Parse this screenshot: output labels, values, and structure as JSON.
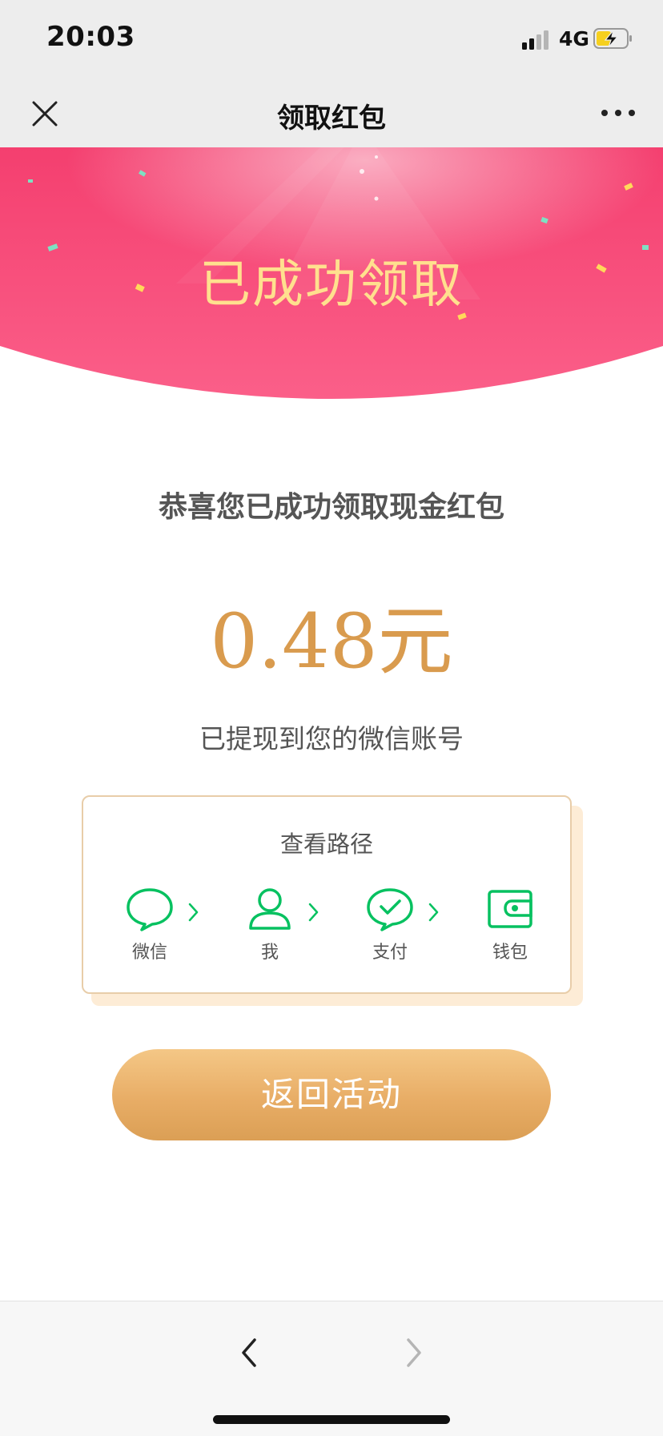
{
  "status_bar": {
    "time": "20:03",
    "network": "4G",
    "icons": [
      "signal-icon",
      "battery-charging-icon"
    ]
  },
  "nav": {
    "title": "领取红包",
    "close_icon": "close-icon",
    "more_icon": "more-icon"
  },
  "banner": {
    "title": "已成功领取"
  },
  "content": {
    "congrats": "恭喜您已成功领取现金红包",
    "amount": "0.48元",
    "withdrawn": "已提现到您的微信账号"
  },
  "path_card": {
    "title": "查看路径",
    "steps": [
      {
        "label": "微信",
        "icon": "chat-bubble-icon"
      },
      {
        "label": "我",
        "icon": "user-icon"
      },
      {
        "label": "支付",
        "icon": "payment-check-icon"
      },
      {
        "label": "钱包",
        "icon": "wallet-icon"
      }
    ]
  },
  "return_button": {
    "label": "返回活动"
  },
  "colors": {
    "banner_pink": "#f5497a",
    "banner_title": "#ffe08e",
    "amount": "#d99b4e",
    "icon_green": "#07c160",
    "button_gold": "#e8ad66"
  }
}
